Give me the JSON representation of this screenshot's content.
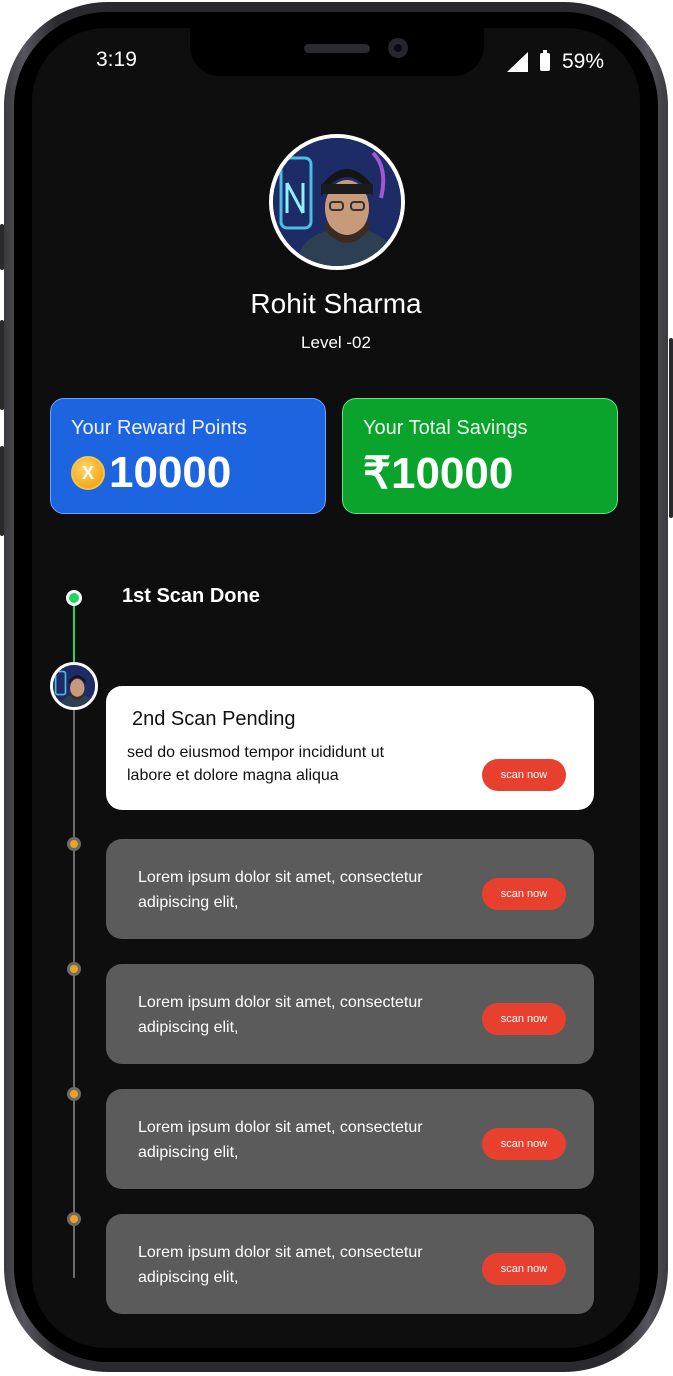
{
  "status_bar": {
    "time": "3:19",
    "battery_percent": "59%"
  },
  "profile": {
    "name": "Rohit Sharma",
    "level": "Level -02"
  },
  "cards": {
    "reward_title": "Your Reward Points",
    "reward_value": "10000",
    "reward_coin_symbol": "X",
    "savings_title": "Your Total Savings",
    "savings_value": "₹10000"
  },
  "timeline": {
    "done_label": "1st Scan Done",
    "pending": {
      "title": "2nd Scan Pending",
      "description": "sed do eiusmod tempor incididunt ut labore et dolore magna aliqua",
      "button_label": "scan now"
    },
    "steps": [
      {
        "text": "Lorem ipsum dolor sit amet, consectetur adipiscing elit,",
        "button_label": "scan now"
      },
      {
        "text": "Lorem ipsum dolor sit amet, consectetur adipiscing elit,",
        "button_label": "scan now"
      },
      {
        "text": "Lorem ipsum dolor sit amet, consectetur adipiscing elit,",
        "button_label": "scan now"
      },
      {
        "text": "Lorem ipsum dolor sit amet, consectetur adipiscing elit,",
        "button_label": "scan now"
      }
    ]
  },
  "colors": {
    "reward_card": "#1d64e0",
    "savings_card": "#0aa32c",
    "accent_green": "#1dd760",
    "scan_button": "#e8402f",
    "step_dot": "#f2a11c"
  }
}
